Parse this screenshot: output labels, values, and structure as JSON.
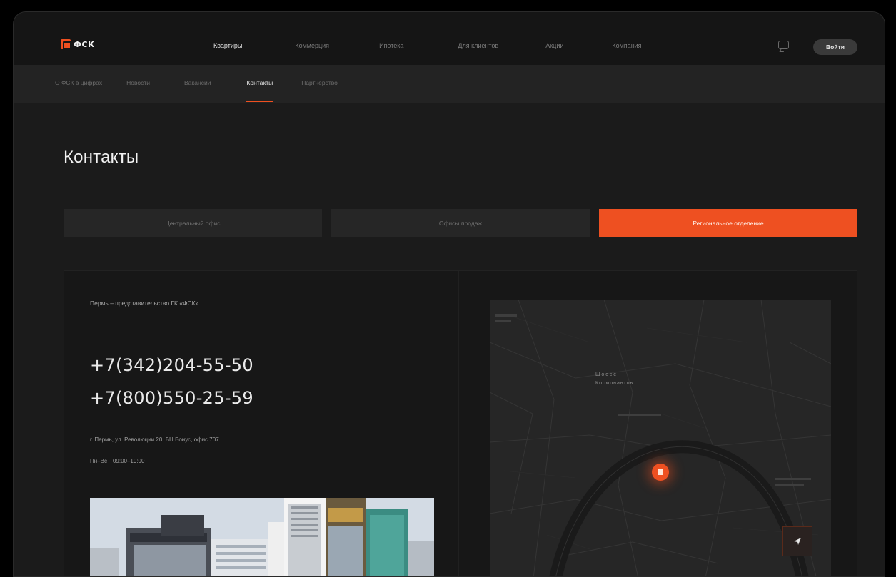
{
  "header": {
    "logo_text": "ФСК",
    "nav": [
      "Квартиры",
      "Коммерция",
      "Ипотека",
      "Для клиентов",
      "Акции",
      "Компания"
    ],
    "nav_active": 0,
    "login_label": "Войти"
  },
  "subnav": {
    "items": [
      "О ФСК в цифрах",
      "Новости",
      "Вакансии",
      "Контакты",
      "Партнерство"
    ],
    "active": 3
  },
  "page_title": "Контакты",
  "tabs": {
    "items": [
      "Центральный офис",
      "Офисы продаж",
      "Региональное отделение"
    ],
    "active": 2
  },
  "office": {
    "title": "Пермь – представительство ГК «ФСК»",
    "phone_1": "+7(342)204-55-50",
    "phone_2": "+7(800)550-25-59",
    "address": "г. Пермь, ул. Революции 20, БЦ Бонус, офис 707",
    "hours_days": "Пн–Вс",
    "hours_time": "09:00–19:00"
  },
  "map": {
    "label_line1": "Шоссе",
    "label_line2": "Космонавтов"
  },
  "colors": {
    "accent": "#ee5021",
    "background": "#1b1b1b",
    "header": "#151515",
    "subheader": "#232323"
  }
}
